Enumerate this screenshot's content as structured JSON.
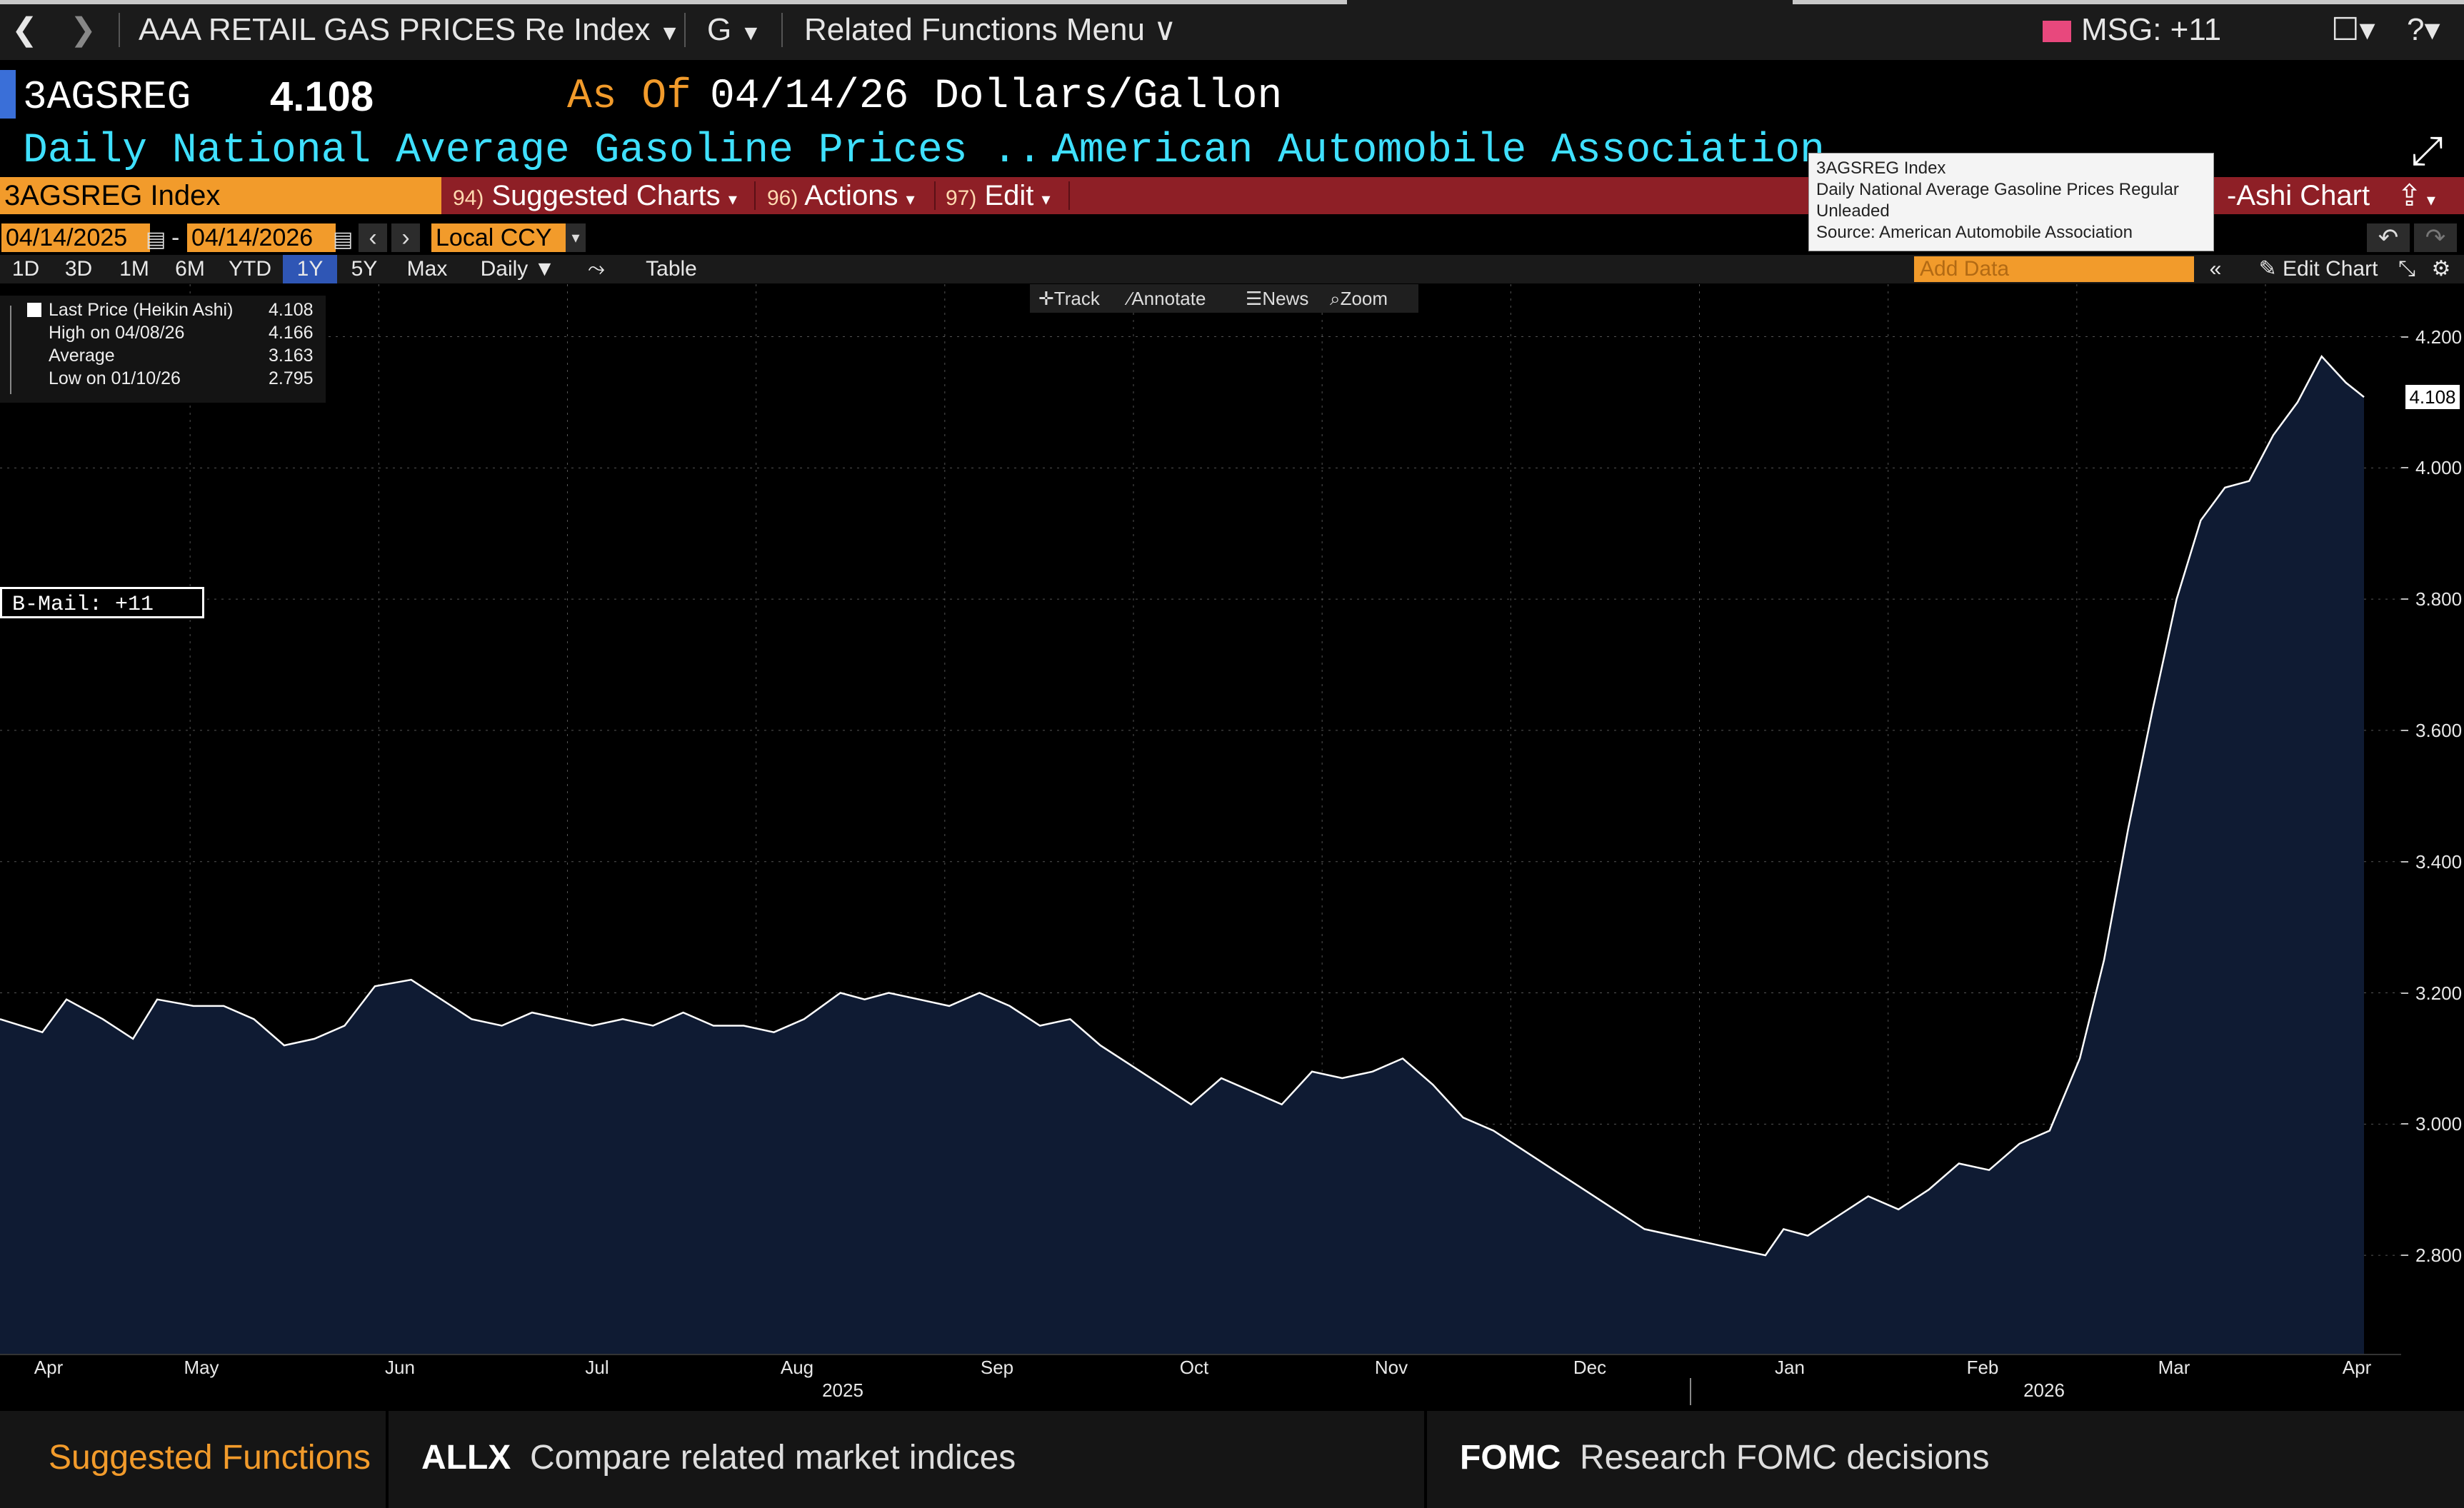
{
  "nav": {
    "title": "AAA RETAIL GAS PRICES Re Index",
    "g_label": "G",
    "related": "Related Functions Menu",
    "msg": "MSG: +11"
  },
  "header": {
    "ticker": "3AGSREG",
    "last": "4.108",
    "as_of_label": "As Of",
    "as_of_date": "04/14/26",
    "units": "Dollars/Gallon",
    "description": "Daily National Average Gasoline Prices ...",
    "source": "American Automobile Association"
  },
  "function_bar": {
    "security": "3AGSREG Index",
    "suggested_num": "94)",
    "suggested": "Suggested Charts",
    "actions_num": "96)",
    "actions": "Actions",
    "edit_num": "97)",
    "edit": "Edit",
    "chart_type": "-Ashi Chart"
  },
  "tooltip": {
    "line1": "3AGSREG  Index",
    "line2": "Daily National Average Gasoline Prices Regular",
    "line3": "Unleaded",
    "line4": "Source: American Automobile Association"
  },
  "dates": {
    "start": "04/14/2025",
    "end": "04/14/2026",
    "dash": "-",
    "currency": "Local CCY"
  },
  "periods": [
    "1D",
    "3D",
    "1M",
    "6M",
    "YTD",
    "1Y",
    "5Y",
    "Max"
  ],
  "active_period": "1Y",
  "frequency": "Daily",
  "table_label": "Table",
  "add_data_placeholder": "Add Data",
  "edit_chart": "Edit Chart",
  "tools": {
    "track": "Track",
    "annotate": "Annotate",
    "news": "News",
    "zoom": "Zoom"
  },
  "legend": {
    "last_label": "Last Price (Heikin Ashi)",
    "last_value": "4.108",
    "high_label": "High on 04/08/26",
    "high_value": "4.166",
    "avg_label": "Average",
    "avg_value": "3.163",
    "low_label": "Low on 01/10/26",
    "low_value": "2.795"
  },
  "bmail": "B-Mail: +11",
  "chart_data": {
    "type": "area",
    "series": [
      {
        "name": "Last Price (Heikin Ashi)",
        "points": [
          [
            "2025-04-14",
            3.16
          ],
          [
            "2025-04-21",
            3.14
          ],
          [
            "2025-04-25",
            3.19
          ],
          [
            "2025-05-01",
            3.16
          ],
          [
            "2025-05-06",
            3.13
          ],
          [
            "2025-05-10",
            3.19
          ],
          [
            "2025-05-16",
            3.18
          ],
          [
            "2025-05-21",
            3.18
          ],
          [
            "2025-05-26",
            3.16
          ],
          [
            "2025-05-31",
            3.12
          ],
          [
            "2025-06-05",
            3.13
          ],
          [
            "2025-06-10",
            3.15
          ],
          [
            "2025-06-15",
            3.21
          ],
          [
            "2025-06-21",
            3.22
          ],
          [
            "2025-06-26",
            3.19
          ],
          [
            "2025-07-01",
            3.16
          ],
          [
            "2025-07-06",
            3.15
          ],
          [
            "2025-07-11",
            3.17
          ],
          [
            "2025-07-16",
            3.16
          ],
          [
            "2025-07-21",
            3.15
          ],
          [
            "2025-07-26",
            3.16
          ],
          [
            "2025-07-31",
            3.15
          ],
          [
            "2025-08-05",
            3.17
          ],
          [
            "2025-08-10",
            3.15
          ],
          [
            "2025-08-15",
            3.15
          ],
          [
            "2025-08-20",
            3.14
          ],
          [
            "2025-08-25",
            3.16
          ],
          [
            "2025-08-31",
            3.2
          ],
          [
            "2025-09-04",
            3.19
          ],
          [
            "2025-09-08",
            3.2
          ],
          [
            "2025-09-13",
            3.19
          ],
          [
            "2025-09-18",
            3.18
          ],
          [
            "2025-09-23",
            3.2
          ],
          [
            "2025-09-28",
            3.18
          ],
          [
            "2025-10-03",
            3.15
          ],
          [
            "2025-10-08",
            3.16
          ],
          [
            "2025-10-13",
            3.12
          ],
          [
            "2025-10-18",
            3.09
          ],
          [
            "2025-10-23",
            3.06
          ],
          [
            "2025-10-28",
            3.03
          ],
          [
            "2025-11-02",
            3.07
          ],
          [
            "2025-11-07",
            3.05
          ],
          [
            "2025-11-12",
            3.03
          ],
          [
            "2025-11-17",
            3.08
          ],
          [
            "2025-11-22",
            3.07
          ],
          [
            "2025-11-27",
            3.08
          ],
          [
            "2025-12-02",
            3.1
          ],
          [
            "2025-12-07",
            3.06
          ],
          [
            "2025-12-12",
            3.01
          ],
          [
            "2025-12-17",
            2.99
          ],
          [
            "2025-12-22",
            2.96
          ],
          [
            "2025-12-27",
            2.93
          ],
          [
            "2026-01-01",
            2.9
          ],
          [
            "2026-01-06",
            2.87
          ],
          [
            "2026-01-11",
            2.84
          ],
          [
            "2026-01-16",
            2.83
          ],
          [
            "2026-01-21",
            2.82
          ],
          [
            "2026-01-26",
            2.81
          ],
          [
            "2026-01-31",
            2.8
          ],
          [
            "2026-02-03",
            2.84
          ],
          [
            "2026-02-07",
            2.83
          ],
          [
            "2026-02-12",
            2.86
          ],
          [
            "2026-02-17",
            2.89
          ],
          [
            "2026-02-22",
            2.87
          ],
          [
            "2026-02-27",
            2.9
          ],
          [
            "2026-03-04",
            2.94
          ],
          [
            "2026-03-09",
            2.93
          ],
          [
            "2026-03-14",
            2.97
          ],
          [
            "2026-03-19",
            2.99
          ],
          [
            "2026-03-24",
            3.1
          ],
          [
            "2026-03-28",
            3.25
          ],
          [
            "2026-04-01",
            3.45
          ],
          [
            "2026-04-05",
            3.63
          ],
          [
            "2026-04-09",
            3.8
          ],
          [
            "2026-04-13",
            3.92
          ],
          [
            "2026-04-17",
            3.97
          ],
          [
            "2026-04-21",
            3.98
          ],
          [
            "2026-04-25",
            4.05
          ],
          [
            "2026-04-29",
            4.1
          ],
          [
            "2026-05-03",
            4.17
          ],
          [
            "2026-05-07",
            4.13
          ],
          [
            "2026-05-10",
            4.108
          ]
        ]
      }
    ],
    "y_ticks": [
      "2.800",
      "3.000",
      "3.200",
      "3.400",
      "3.600",
      "3.800",
      "4.000",
      "4.200"
    ],
    "ylim": [
      2.65,
      4.28
    ],
    "x_labels": [
      "Apr",
      "May",
      "Jun",
      "Jul",
      "Aug",
      "Sep",
      "Oct",
      "Nov",
      "Dec",
      "Jan",
      "Feb",
      "Mar",
      "Apr"
    ],
    "year_labels": [
      "2025",
      "2026"
    ],
    "last_value_label": "4.108",
    "grid": true
  },
  "bottom": {
    "title": "Suggested Functions",
    "f1_code": "ALLX",
    "f1_desc": "Compare related market indices",
    "f2_code": "FOMC",
    "f2_desc": "Research FOMC decisions"
  },
  "colors": {
    "accent": "#f29b2b",
    "function_bar": "#8e1f26",
    "area_fill": "#0f1b33",
    "line": "#ffffff",
    "cyan": "#3fe0ff"
  }
}
